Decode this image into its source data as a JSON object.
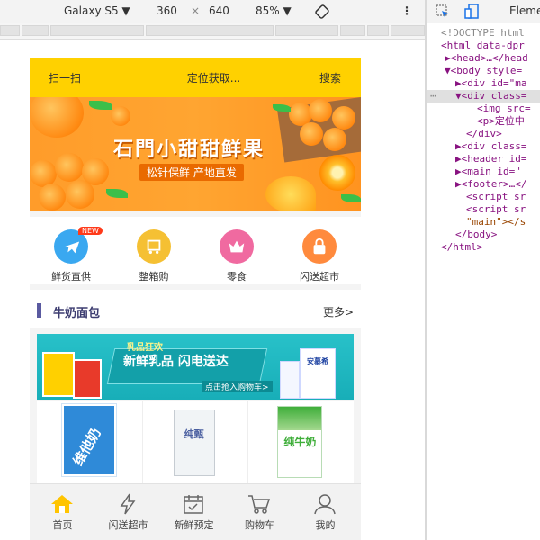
{
  "devtoolbar": {
    "device": "Galaxy S5",
    "width": "360",
    "times": "×",
    "height": "640",
    "zoom": "85%",
    "more_icon": "⋮"
  },
  "phone": {
    "topbar": {
      "scan": "扫一扫",
      "location": "定位获取...",
      "search": "搜索"
    },
    "banner": {
      "title": "石門小甜甜鲜果",
      "subtitle": "松针保鲜 产地直发"
    },
    "icons": [
      {
        "label": "鲜货直供",
        "icon": "plane-icon",
        "color": "#3aa8f0",
        "badge": "NEW"
      },
      {
        "label": "整箱购",
        "icon": "cart-box-icon",
        "color": "#f5c033"
      },
      {
        "label": "零食",
        "icon": "crown-icon",
        "color": "#f06aa0"
      },
      {
        "label": "闪送超市",
        "icon": "lock-bag-icon",
        "color": "#ff8a3d"
      }
    ],
    "section": {
      "title": "牛奶面包",
      "more": "更多>"
    },
    "milk_banner": {
      "tag": "乳品狂欢",
      "title": "新鲜乳品 闪电送达",
      "cta": "点击抢入购物车>",
      "brand": "安慕希"
    },
    "products": [
      "维他奶",
      "纯甄",
      "纯牛奶"
    ],
    "tabs": [
      {
        "label": "首页",
        "icon": "home-icon",
        "active": true
      },
      {
        "label": "闪送超市",
        "icon": "lightning-icon"
      },
      {
        "label": "新鲜预定",
        "icon": "calendar-icon"
      },
      {
        "label": "购物车",
        "icon": "cart-icon"
      },
      {
        "label": "我的",
        "icon": "user-icon"
      }
    ]
  },
  "devtools": {
    "tab": "Eleme",
    "lines": [
      "<!DOCTYPE html",
      "<html data-dpr",
      "▶<head>…</head",
      "▼<body style=",
      "▶<div id=\"ma",
      "▼<div class=",
      "<img src=",
      "<p>定位中",
      "</div>",
      "▶<div class=",
      "▶<header id=",
      "▶<main id=\"",
      "▶<footer>…</",
      "<script sr",
      "<script sr",
      "\"main\"></s",
      "</body>",
      "</html>"
    ]
  }
}
